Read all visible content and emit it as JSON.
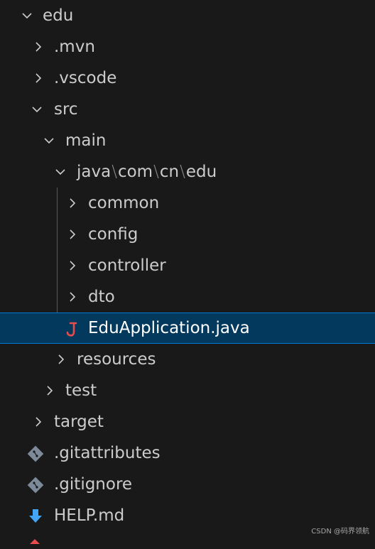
{
  "explorer": {
    "items": [
      {
        "label": "edu",
        "kind": "folder",
        "expanded": true
      },
      {
        "label": ".mvn",
        "kind": "folder",
        "expanded": false
      },
      {
        "label": ".vscode",
        "kind": "folder",
        "expanded": false
      },
      {
        "label": "src",
        "kind": "folder",
        "expanded": true
      },
      {
        "label": "main",
        "kind": "folder",
        "expanded": true
      },
      {
        "label": "java",
        "kind": "folder",
        "expanded": true,
        "path_parts": [
          "java",
          "com",
          "cn",
          "edu"
        ],
        "separator": "\\"
      },
      {
        "label": "common",
        "kind": "folder",
        "expanded": false
      },
      {
        "label": "config",
        "kind": "folder",
        "expanded": false
      },
      {
        "label": "controller",
        "kind": "folder",
        "expanded": false
      },
      {
        "label": "dto",
        "kind": "folder",
        "expanded": false
      },
      {
        "label": "EduApplication.java",
        "kind": "file",
        "icon": "java-file-icon",
        "selected": true
      },
      {
        "label": "resources",
        "kind": "folder",
        "expanded": false
      },
      {
        "label": "test",
        "kind": "folder",
        "expanded": false
      },
      {
        "label": "target",
        "kind": "folder",
        "expanded": false
      },
      {
        "label": ".gitattributes",
        "kind": "file",
        "icon": "git-file-icon"
      },
      {
        "label": ".gitignore",
        "kind": "file",
        "icon": "git-file-icon"
      },
      {
        "label": "HELP.md",
        "kind": "file",
        "icon": "markdown-download-icon"
      }
    ]
  },
  "watermark": "CSDN @码界领航",
  "colors": {
    "background": "#191919",
    "selection": "#04395e",
    "selection_border": "#0078d4",
    "java_icon": "#e84d4d",
    "git_icon": "#7c8a99",
    "md_icon": "#42a5f5"
  }
}
